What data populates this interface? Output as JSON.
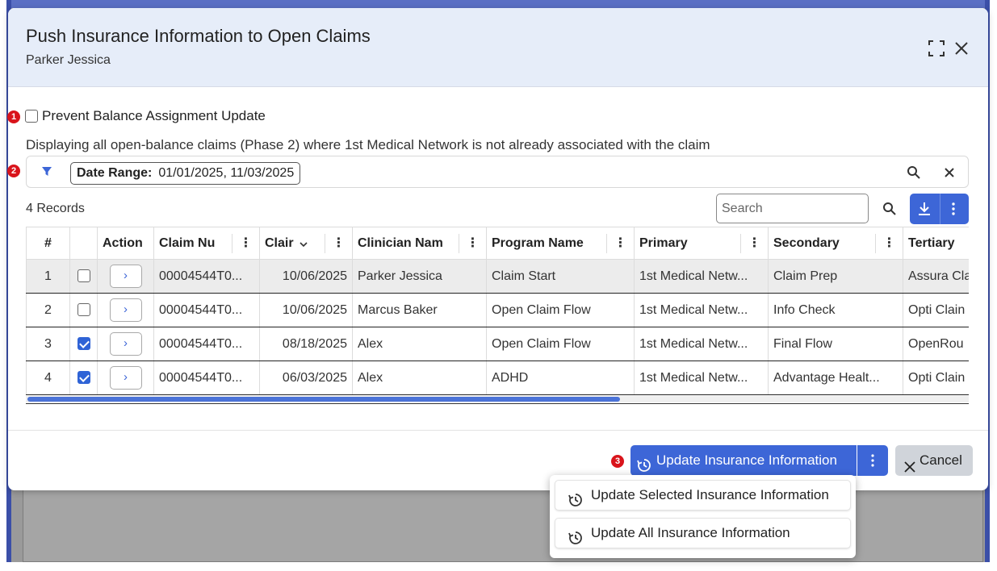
{
  "dialog": {
    "title": "Push Insurance Information to Open Claims",
    "subtitle": "Parker Jessica",
    "maximize_icon": "maximize-icon",
    "close_icon": "close-icon"
  },
  "markers": [
    "1",
    "2",
    "3"
  ],
  "prevent_balance": {
    "label": "Prevent Balance Assignment Update",
    "checked": false
  },
  "info_text": "Displaying all open-balance claims (Phase 2) where 1st Medical Network is not already associated with the claim",
  "filter": {
    "icon": "filter-icon",
    "pill_label": "Date Range:",
    "pill_value": "01/01/2025, 11/03/2025"
  },
  "records_label": "4 Records",
  "search": {
    "placeholder": "Search"
  },
  "table": {
    "headers": {
      "index": "#",
      "action": "Action",
      "claim_number": "Claim Nu",
      "claim_date": "Clair",
      "clinician": "Clinician Nam",
      "program": "Program Name",
      "primary": "Primary",
      "secondary": "Secondary",
      "tertiary": "Tertiary"
    },
    "rows": [
      {
        "index": "1",
        "checked": false,
        "claim_number": "00004544T0...",
        "claim_date": "10/06/2025",
        "clinician": "Parker Jessica",
        "program": "Claim Start",
        "primary": "1st Medical Netw...",
        "secondary": "Claim Prep",
        "tertiary": "Assura Cla"
      },
      {
        "index": "2",
        "checked": false,
        "claim_number": "00004544T0...",
        "claim_date": "10/06/2025",
        "clinician": "Marcus Baker",
        "program": "Open Claim Flow",
        "primary": "1st Medical Netw...",
        "secondary": "Info Check",
        "tertiary": "Opti Clain"
      },
      {
        "index": "3",
        "checked": true,
        "claim_number": "00004544T0...",
        "claim_date": "08/18/2025",
        "clinician": "Alex",
        "program": "Open Claim Flow",
        "primary": "1st Medical Netw...",
        "secondary": "Final Flow",
        "tertiary": "OpenRou"
      },
      {
        "index": "4",
        "checked": true,
        "claim_number": "00004544T0...",
        "claim_date": "06/03/2025",
        "clinician": "Alex",
        "program": "ADHD",
        "primary": "1st Medical Netw...",
        "secondary": "Advantage Healt...",
        "tertiary": "Opti Clain"
      }
    ]
  },
  "footer": {
    "update_label": "Update Insurance Information",
    "cancel_label": "Cancel"
  },
  "dropdown": {
    "items": [
      {
        "label": "Update Selected Insurance Information"
      },
      {
        "label": "Update All Insurance Information"
      }
    ]
  },
  "colors": {
    "accent": "#3d66d7",
    "header_bg": "#e6edf9",
    "marker": "#d9141b"
  }
}
